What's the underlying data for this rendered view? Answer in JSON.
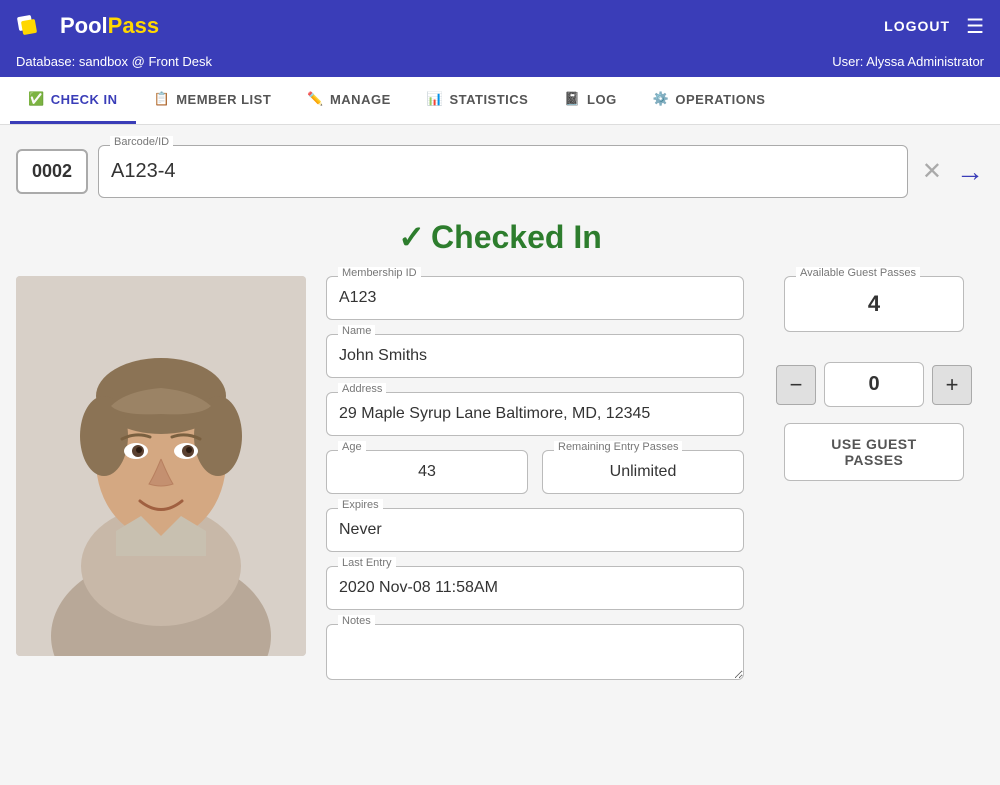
{
  "header": {
    "logo_pool": "Pool",
    "logo_pass": "Pass",
    "logout_label": "LOGOUT",
    "database_info": "Database: sandbox @ Front Desk",
    "user_info": "User: Alyssa Administrator"
  },
  "nav": {
    "items": [
      {
        "id": "check-in",
        "label": "CHECK IN",
        "icon": "✅",
        "active": true
      },
      {
        "id": "member-list",
        "label": "MEMBER LIST",
        "icon": "📋",
        "active": false
      },
      {
        "id": "manage",
        "label": "MANAGE",
        "icon": "✏️",
        "active": false
      },
      {
        "id": "statistics",
        "label": "STATISTICS",
        "icon": "📊",
        "active": false
      },
      {
        "id": "log",
        "label": "LOG",
        "icon": "📓",
        "active": false
      },
      {
        "id": "operations",
        "label": "OPERATIONS",
        "icon": "⚙️",
        "active": false
      }
    ]
  },
  "barcode_section": {
    "queue_number": "0002",
    "barcode_label": "Barcode/ID",
    "barcode_value": "A123-4"
  },
  "status_banner": {
    "check_mark": "✓",
    "text": "Checked In"
  },
  "member": {
    "membership_id_label": "Membership ID",
    "membership_id": "A123",
    "name_label": "Name",
    "name": "John Smiths",
    "address_label": "Address",
    "address": "29 Maple Syrup Lane Baltimore, MD, 12345",
    "age_label": "Age",
    "age": "43",
    "remaining_passes_label": "Remaining Entry Passes",
    "remaining_passes": "Unlimited",
    "expires_label": "Expires",
    "expires": "Never",
    "last_entry_label": "Last Entry",
    "last_entry": "2020 Nov-08 11:58AM",
    "notes_label": "Notes",
    "notes": ""
  },
  "guest_passes": {
    "available_label": "Available Guest Passes",
    "available_count": "4",
    "counter_value": "0",
    "decrement_label": "−",
    "increment_label": "+",
    "use_button_label": "USE GUEST PASSES"
  }
}
